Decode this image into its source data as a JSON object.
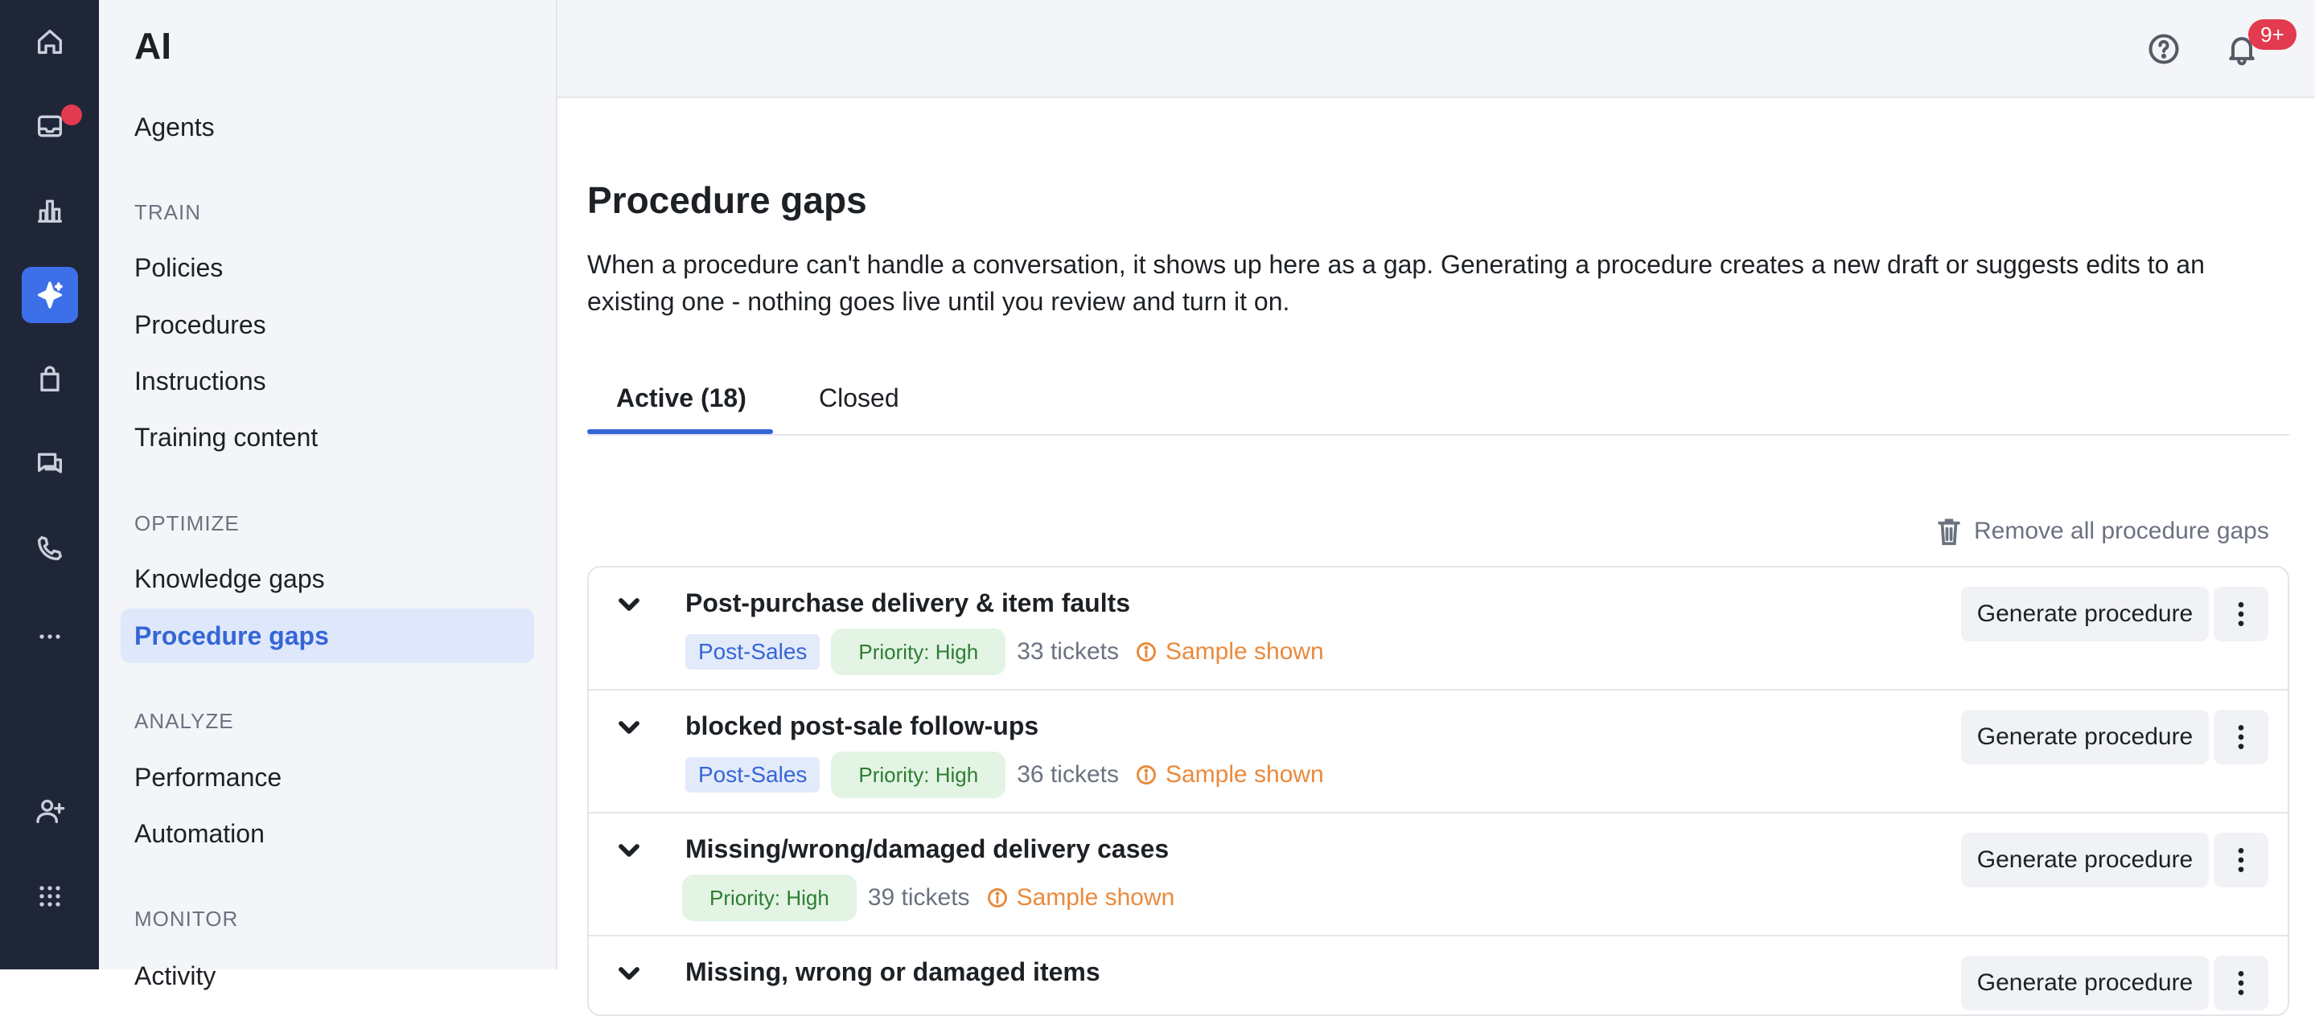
{
  "sidebar": {
    "title": "AI",
    "agents": "Agents",
    "sections": [
      {
        "label": "TRAIN",
        "items": [
          "Policies",
          "Procedures",
          "Instructions",
          "Training content"
        ]
      },
      {
        "label": "OPTIMIZE",
        "items": [
          "Knowledge gaps",
          "Procedure gaps"
        ]
      },
      {
        "label": "ANALYZE",
        "items": [
          "Performance",
          "Automation"
        ]
      },
      {
        "label": "MONITOR",
        "items": [
          "Activity"
        ]
      }
    ],
    "active_item": "Procedure gaps"
  },
  "rail": {
    "icons": [
      "home-icon",
      "inbox-icon",
      "reports-icon",
      "ai-sparkle-icon",
      "shopping-bag-icon",
      "chat-icon",
      "phone-icon",
      "more-icon",
      "add-user-icon",
      "apps-grid-icon"
    ],
    "active": "ai-sparkle-icon"
  },
  "header": {
    "notifications_badge": "9+"
  },
  "main": {
    "title": "Procedure gaps",
    "description": "When a procedure can't handle a conversation, it shows up here as a gap. Generating a procedure creates a new draft or suggests edits to an existing one - nothing goes live until you review and turn it on.",
    "tabs": [
      {
        "label": "Active (18)",
        "active": true
      },
      {
        "label": "Closed",
        "active": false
      }
    ],
    "remove_all_label": "Remove all procedure gaps",
    "gaps": [
      {
        "title": "Post-purchase delivery & item faults",
        "category": "Post-Sales",
        "priority": "Priority: High",
        "tickets": "33 tickets",
        "sample": "Sample shown",
        "action": "Generate procedure"
      },
      {
        "title": "blocked post-sale follow-ups",
        "category": "Post-Sales",
        "priority": "Priority: High",
        "tickets": "36 tickets",
        "sample": "Sample shown",
        "action": "Generate procedure"
      },
      {
        "title": "Missing/wrong/damaged delivery cases",
        "category": "",
        "priority": "Priority: High",
        "tickets": "39 tickets",
        "sample": "Sample shown",
        "action": "Generate procedure"
      },
      {
        "title": "Missing, wrong or damaged items",
        "category": "",
        "priority": "",
        "tickets": "",
        "sample": "",
        "action": "Generate procedure"
      }
    ]
  },
  "colors": {
    "rail_bg": "#1f2637",
    "accent": "#3566d6",
    "badge_red": "#e23a4e",
    "sample_orange": "#e98a3c",
    "priority_green": "#2e7d32"
  }
}
